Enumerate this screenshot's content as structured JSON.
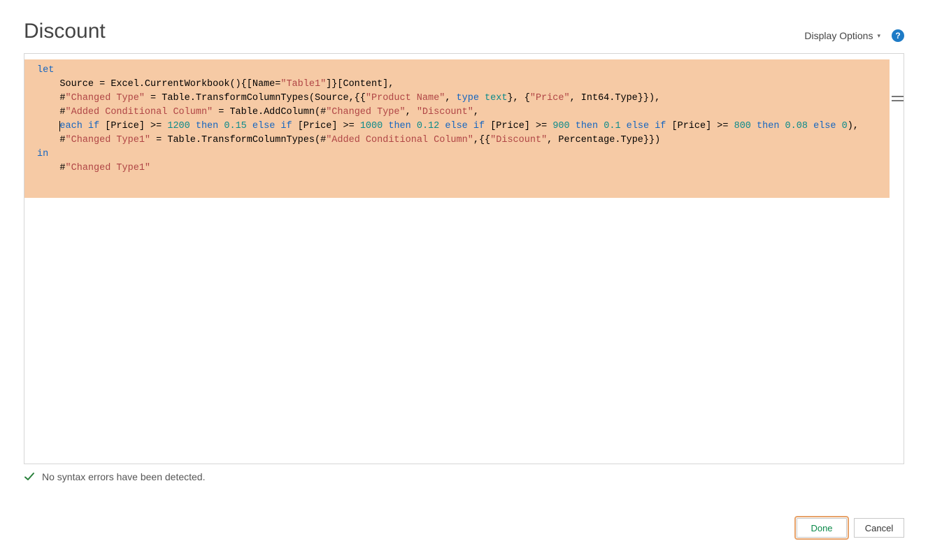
{
  "title": "Discount",
  "header": {
    "display_options_label": "Display Options"
  },
  "code": {
    "line1_let": "let",
    "line2_a": "    Source = Excel.CurrentWorkbook(){[Name=",
    "line2_str": "\"Table1\"",
    "line2_b": "]}[Content],",
    "line3_a": "    #",
    "line3_str1": "\"Changed Type\"",
    "line3_b": " = Table.TransformColumnTypes(Source,{{",
    "line3_str2": "\"Product Name\"",
    "line3_c": ", ",
    "line3_kw_type": "type",
    "line3_sp": " ",
    "line3_kw_text": "text",
    "line3_d": "}, {",
    "line3_str3": "\"Price\"",
    "line3_e": ", Int64.Type}}),",
    "line4_a": "    #",
    "line4_str1": "\"Added Conditional Column\"",
    "line4_b": " = Table.AddColumn(#",
    "line4_str2": "\"Changed Type\"",
    "line4_c": ", ",
    "line4_str3": "\"Discount\"",
    "line4_d": ",",
    "line5_pad": "    ",
    "line5_kw_each": "each",
    "line5_a": " ",
    "line5_kw_if1": "if",
    "line5_b": " [Price] >= ",
    "line5_n1": "1200",
    "line5_sp1": " ",
    "line5_kw_then1": "then",
    "line5_sp1b": " ",
    "line5_n2": "0.15",
    "line5_sp2": " ",
    "line5_kw_else1": "else",
    "line5_sp2b": " ",
    "line5_kw_if2": "if",
    "line5_c": " [Price] >= ",
    "line5_n3": "1000",
    "line5_sp3": " ",
    "line5_kw_then2": "then",
    "line5_sp3b": " ",
    "line5_n4": "0.12",
    "line5_sp4": " ",
    "line5_kw_else2": "else",
    "line5_sp4b": " ",
    "line5_kw_if3": "if",
    "line5_d": " [Price] >= ",
    "line5_n5": "900",
    "line5_sp5": " ",
    "line5_kw_then3": "then",
    "line5_sp5b": " ",
    "line5_n6": "0.1",
    "line5_sp6": " ",
    "line5_kw_else3": "else",
    "line5_sp6b": " ",
    "line5_kw_if4": "if",
    "line5_e": " [Price] >= ",
    "line5_n7": "800",
    "line5_sp7": " ",
    "line5_kw_then4": "then",
    "line5_sp7b": " ",
    "line5_n8": "0.08",
    "line5_sp8": " ",
    "line5_kw_else4": "else",
    "line5_sp8b": " ",
    "line5_n9": "0",
    "line5_f": "),",
    "line6_a": "    #",
    "line6_str1": "\"Changed Type1\"",
    "line6_b": " = Table.TransformColumnTypes(#",
    "line6_str2": "\"Added Conditional Column\"",
    "line6_c": ",{{",
    "line6_str3": "\"Discount\"",
    "line6_d": ", Percentage.Type}})",
    "line7_in": "in",
    "line8_a": "    #",
    "line8_str": "\"Changed Type1\""
  },
  "status": "No syntax errors have been detected.",
  "buttons": {
    "done": "Done",
    "cancel": "Cancel"
  }
}
